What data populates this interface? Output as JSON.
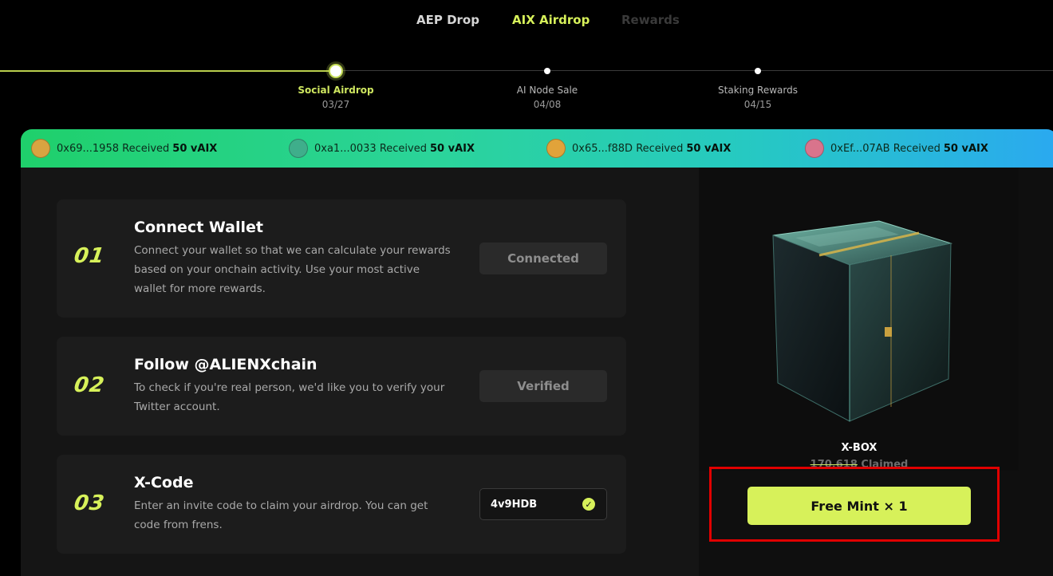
{
  "tabs": [
    {
      "label": "AEP Drop",
      "state": "default"
    },
    {
      "label": "AIX Airdrop",
      "state": "active"
    },
    {
      "label": "Rewards",
      "state": "disabled"
    }
  ],
  "timeline": [
    {
      "name": "Social Airdrop",
      "date": "03/27",
      "active": true
    },
    {
      "name": "AI Node Sale",
      "date": "04/08",
      "active": false
    },
    {
      "name": "Staking Rewards",
      "date": "04/15",
      "active": false
    }
  ],
  "ticker": [
    {
      "address": "0x69...1958",
      "text": "Received",
      "amount": "50 vAIX",
      "avatar_color": "#d9a441"
    },
    {
      "address": "0xa1...0033",
      "text": "Received",
      "amount": "50 vAIX",
      "avatar_color": "#3fae8b"
    },
    {
      "address": "0x65...f88D",
      "text": "Received",
      "amount": "50 vAIX",
      "avatar_color": "#e1a33a"
    },
    {
      "address": "0xEf...07AB",
      "text": "Received",
      "amount": "50 vAIX",
      "avatar_color": "#d9748c"
    }
  ],
  "tasks": [
    {
      "num": "01",
      "title": "Connect Wallet",
      "desc": "Connect your wallet so that we can calculate your rewards based on your onchain activity. Use your most active wallet for more rewards.",
      "button": "Connected"
    },
    {
      "num": "02",
      "title": "Follow @ALIENXchain",
      "desc": "To check if you're real person, we'd like you to verify your Twitter account.",
      "button": "Verified"
    },
    {
      "num": "03",
      "title": "X-Code",
      "desc": "Enter an invite code to claim your airdrop. You can get code from frens.",
      "code": "4v9HDB"
    }
  ],
  "xbox": {
    "name": "X-BOX",
    "claimed_count": "170,618",
    "claimed_label": "Claimed",
    "mint_label": "Free Mint × 1"
  },
  "colors": {
    "accent": "#d7f15a",
    "highlight": "#e00000"
  }
}
